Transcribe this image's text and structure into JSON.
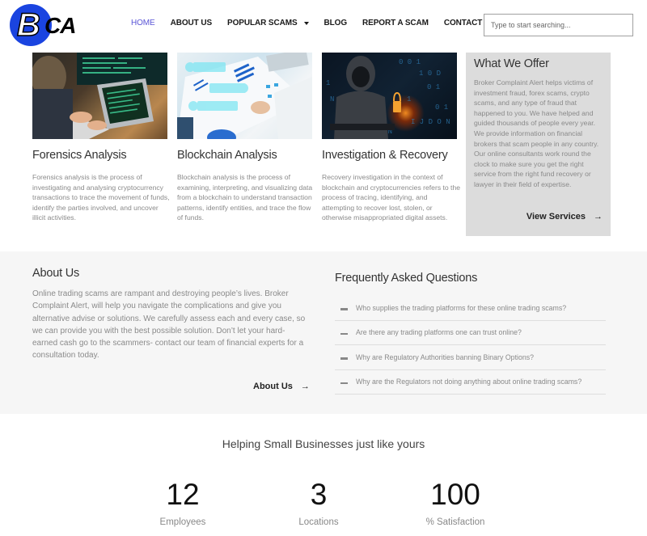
{
  "header": {
    "logo": {
      "letter_b": "B",
      "letters_ca": "CA"
    },
    "nav": [
      {
        "label": "HOME",
        "active": true
      },
      {
        "label": "ABOUT US",
        "active": false
      },
      {
        "label": "POPULAR SCAMS",
        "active": false,
        "has_dropdown": true
      },
      {
        "label": "BLOG",
        "active": false
      },
      {
        "label": "REPORT A SCAM",
        "active": false
      },
      {
        "label": "CONTACT US",
        "active": false
      }
    ],
    "search": {
      "placeholder": "Type to start searching...",
      "value": ""
    }
  },
  "services": [
    {
      "title": "Forensics Analysis",
      "text": "Forensics analysis is the process of investigating and analysing cryptocurrency transactions to trace the movement of funds, identify the parties involved, and uncover illicit activities.",
      "image": "person-typing-on-laptop-with-code"
    },
    {
      "title": "Blockchain Analysis",
      "text": "Blockchain analysis is the process of examining, interpreting, and visualizing data from a blockchain to understand transaction patterns, identify entities, and trace the flow of funds.",
      "image": "business-charts-with-digital-overlay"
    },
    {
      "title": "Investigation & Recovery",
      "text": "Recovery investigation in the context of blockchain and cryptocurrencies refers to the process of tracing, identifying, and attempting to recover lost, stolen, or otherwise misappropriated digital assets.",
      "image": "hooded-hacker-with-padlock"
    }
  ],
  "offer": {
    "title": "What We Offer",
    "text": "Broker Complaint Alert helps victims of investment fraud, forex scams, crypto scams, and any type of fraud that happened to you. We have helped and guided thousands of people every year. We provide information on financial brokers that scam people in any country. Our online consultants work round the clock to make sure you get the right service from the right fund recovery or lawyer in their field of expertise.",
    "link_label": "View Services",
    "link_icon": "arrow-right-icon"
  },
  "about": {
    "title": "About Us",
    "text": "Online trading scams are rampant and destroying people’s lives. Broker Complaint Alert, will help you navigate the complications and give you alternative advise or solutions. We carefully assess each and every case, so we can provide you with the best possible solution. Don’t let your hard-earned cash go to the scammers- contact our team of financial experts for a consultation today.",
    "link_label": "About Us",
    "link_icon": "arrow-right-icon"
  },
  "faq": {
    "title": "Frequently Asked Questions",
    "items": [
      {
        "question": "Who supplies the trading platforms for these online trading scams?",
        "icon": "minus-icon"
      },
      {
        "question": "Are there any trading platforms one can trust online?",
        "icon": "minus-icon"
      },
      {
        "question": "Why are Regulatory Authorities banning Binary Options?",
        "icon": "minus-icon"
      },
      {
        "question": "Why are the Regulators not doing anything about online trading scams?",
        "icon": "minus-icon"
      }
    ]
  },
  "stats": {
    "title": "Helping Small Businesses just like yours",
    "items": [
      {
        "value": "12",
        "label": "Employees"
      },
      {
        "value": "3",
        "label": "Locations"
      },
      {
        "value": "100",
        "label": "% Satisfaction"
      }
    ]
  },
  "colors": {
    "brand_blue": "#1a44e0",
    "nav_active": "#5b56d6",
    "offer_bg": "#dcdcdc",
    "band_bg": "#f6f6f6"
  }
}
